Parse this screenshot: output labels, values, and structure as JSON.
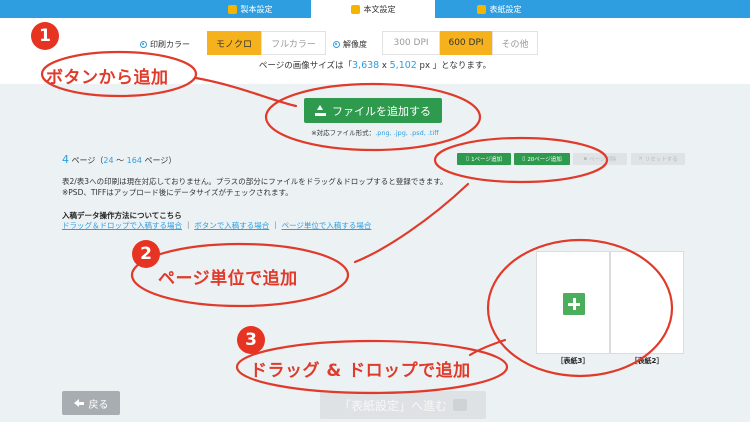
{
  "tabs": [
    {
      "label": "製本設定",
      "icon": "gear-icon"
    },
    {
      "label": "本文設定",
      "icon": "document-icon",
      "active": true
    },
    {
      "label": "表紙設定",
      "icon": "book-icon"
    }
  ],
  "print_color": {
    "label": "印刷カラー",
    "options": [
      "モノクロ",
      "フルカラー"
    ],
    "selected": "モノクロ"
  },
  "resolution": {
    "label": "解像度",
    "options": [
      "300 DPI",
      "600 DPI",
      "その他"
    ],
    "selected": "600 DPI"
  },
  "image_size": {
    "prefix": "ページの画像サイズは「",
    "width": "3,638",
    "sep": " x ",
    "height": "5,102",
    "suffix": " px 」となります。"
  },
  "upload": {
    "button_label": "ファイルを追加する",
    "formats_prefix": "※対応ファイル形式：",
    "formats": ".png, .jpg, .psd, .tiff"
  },
  "page_info": {
    "count": "4",
    "unit": "ページ（",
    "from": "24",
    "tilde": " ～ ",
    "to": "164",
    "suffix": " ページ）"
  },
  "page_buttons": {
    "add_one": "1ページ追加",
    "add_twenty": "20ページ追加",
    "delete": "ページ削除",
    "reset": "リセットする"
  },
  "notice": {
    "line1": "表2/表3への印刷は現在対応しておりません。プラスの部分にファイルをドラッグ＆ドロップすると登録できます。",
    "line2": "※PSD、TIFFはアップロード後にデータサイズがチェックされます。"
  },
  "guide": {
    "heading": "入稿データ操作方法についてこちら",
    "links": [
      "ドラッグ＆ドロップで入稿する場合",
      "ボタンで入稿する場合",
      "ページ単位で入稿する場合"
    ],
    "separator": "｜"
  },
  "covers": [
    {
      "label": "［表紙3］",
      "has_add": true
    },
    {
      "label": "［表紙2］",
      "has_add": false
    }
  ],
  "nav": {
    "back": "戻る",
    "next": "「表紙設定」へ進む"
  },
  "annotations": [
    {
      "number": "1",
      "text": "ボタンから追加"
    },
    {
      "number": "2",
      "text": "ページ単位で追加"
    },
    {
      "number": "3",
      "text": "ドラッグ & ドロップで追加"
    }
  ],
  "colors": {
    "brand_blue": "#2e9ee0",
    "selected_yellow": "#f5b21d",
    "action_green": "#2e9a4d",
    "annotation_red": "#e03a2a"
  }
}
